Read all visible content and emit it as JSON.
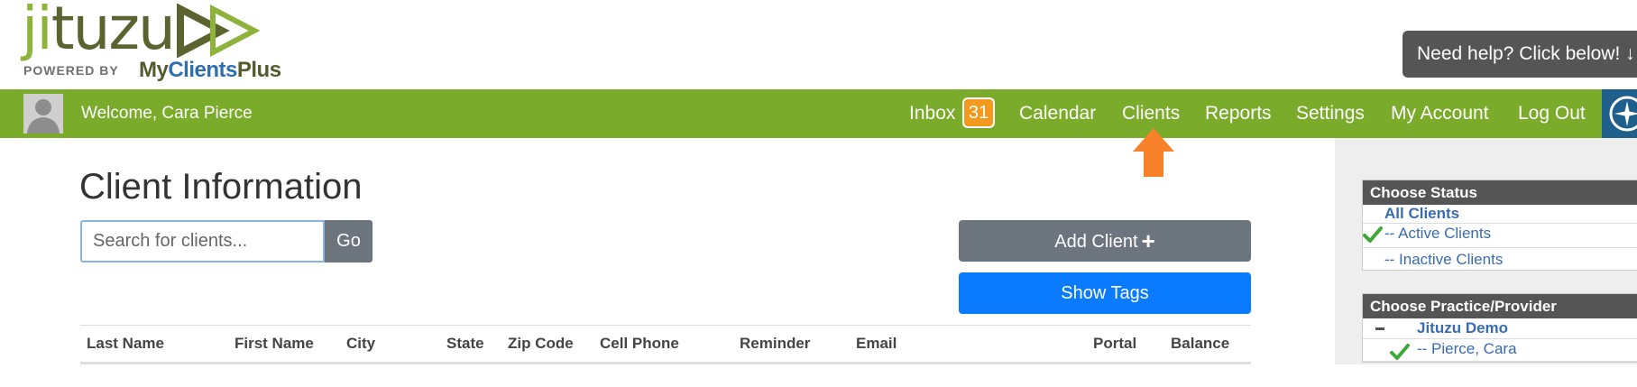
{
  "logo": {
    "word_part1": "ji",
    "word_part2": "tuzu",
    "powered_by": "POWERED BY",
    "brand_part1": "My",
    "brand_part2": "Clients",
    "brand_part3": "Plus",
    "colors": {
      "light_green": "#8db33a",
      "dark_olive": "#5c6330",
      "blue": "#2f6fb0"
    }
  },
  "help": {
    "label": "Need help? Click below! ↓"
  },
  "navbar": {
    "background": "#7aab2a",
    "welcome": "Welcome, Cara Pierce",
    "inbox_label": "Inbox",
    "inbox_count": "31",
    "items": [
      "Calendar",
      "Clients",
      "Reports",
      "Settings",
      "My Account",
      "Log Out"
    ],
    "icons": [
      "user-avatar-icon",
      "compass-icon"
    ]
  },
  "main": {
    "title": "Client Information",
    "search_placeholder": "Search for clients...",
    "go_label": "Go",
    "add_client_label": "Add Client",
    "add_icon": "+",
    "show_tags_label": "Show Tags",
    "table_headers": [
      "Last Name",
      "First Name",
      "City",
      "State",
      "Zip Code",
      "Cell Phone",
      "Reminder",
      "Email",
      "Portal",
      "Balance"
    ]
  },
  "sidebar": {
    "status": {
      "heading": "Choose Status",
      "all": "All Clients",
      "active": "-- Active Clients",
      "inactive": "-- Inactive Clients"
    },
    "practice": {
      "heading": "Choose Practice/Provider",
      "practice_name": "Jituzu Demo",
      "provider": "-- Pierce, Cara"
    }
  },
  "accent_colors": {
    "arrow": "#f7822a",
    "primary_button": "#0a7bff",
    "secondary_button": "#6c757d"
  }
}
